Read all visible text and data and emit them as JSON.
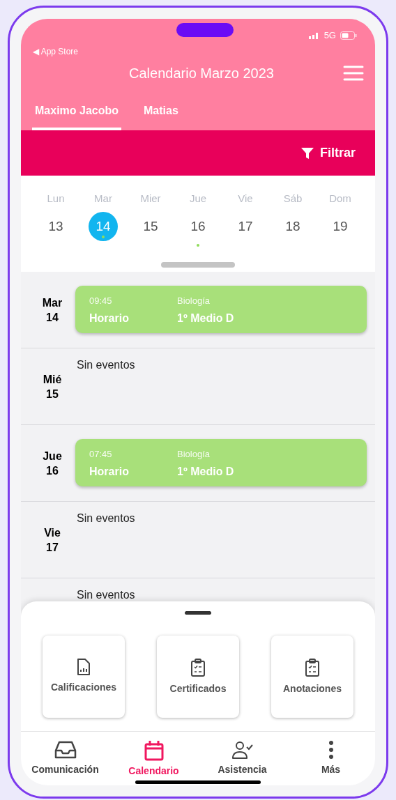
{
  "status_bar": {
    "back_label": "◀ App Store",
    "network": "5G"
  },
  "header": {
    "title": "Calendario Marzo 2023"
  },
  "tabs": [
    {
      "label": "Maximo Jacobo",
      "selected": true
    },
    {
      "label": "Matias",
      "selected": false
    }
  ],
  "filter_button": {
    "label": "Filtrar"
  },
  "week": [
    {
      "weekday": "Lun",
      "day": "13",
      "selected": false,
      "has_events": false
    },
    {
      "weekday": "Mar",
      "day": "14",
      "selected": true,
      "has_events": true
    },
    {
      "weekday": "Mier",
      "day": "15",
      "selected": false,
      "has_events": false
    },
    {
      "weekday": "Jue",
      "day": "16",
      "selected": false,
      "has_events": true
    },
    {
      "weekday": "Vie",
      "day": "17",
      "selected": false,
      "has_events": false
    },
    {
      "weekday": "Sáb",
      "day": "18",
      "selected": false,
      "has_events": false
    },
    {
      "weekday": "Dom",
      "day": "19",
      "selected": false,
      "has_events": false
    }
  ],
  "agenda": [
    {
      "weekday": "Mar",
      "day": "14",
      "events": [
        {
          "time": "09:45",
          "type": "Horario",
          "subject": "Biología",
          "course": "1º Medio D"
        }
      ]
    },
    {
      "weekday": "Mié",
      "day": "15",
      "empty_text": "Sin eventos"
    },
    {
      "weekday": "Jue",
      "day": "16",
      "events": [
        {
          "time": "07:45",
          "type": "Horario",
          "subject": "Biología",
          "course": "1º Medio D"
        }
      ]
    },
    {
      "weekday": "Vie",
      "day": "17",
      "empty_text": "Sin eventos"
    },
    {
      "empty_text": "Sin eventos"
    }
  ],
  "quick_actions": [
    {
      "label": "Calificaciones",
      "kind": "chart"
    },
    {
      "label": "Certificados",
      "kind": "clipboard"
    },
    {
      "label": "Anotaciones",
      "kind": "clipboard"
    }
  ],
  "bottom_nav": [
    {
      "label": "Comunicación",
      "kind": "inbox",
      "selected": false
    },
    {
      "label": "Calendario",
      "kind": "calendar",
      "selected": true
    },
    {
      "label": "Asistencia",
      "kind": "person",
      "selected": false
    },
    {
      "label": "Más",
      "kind": "more",
      "selected": false
    }
  ]
}
